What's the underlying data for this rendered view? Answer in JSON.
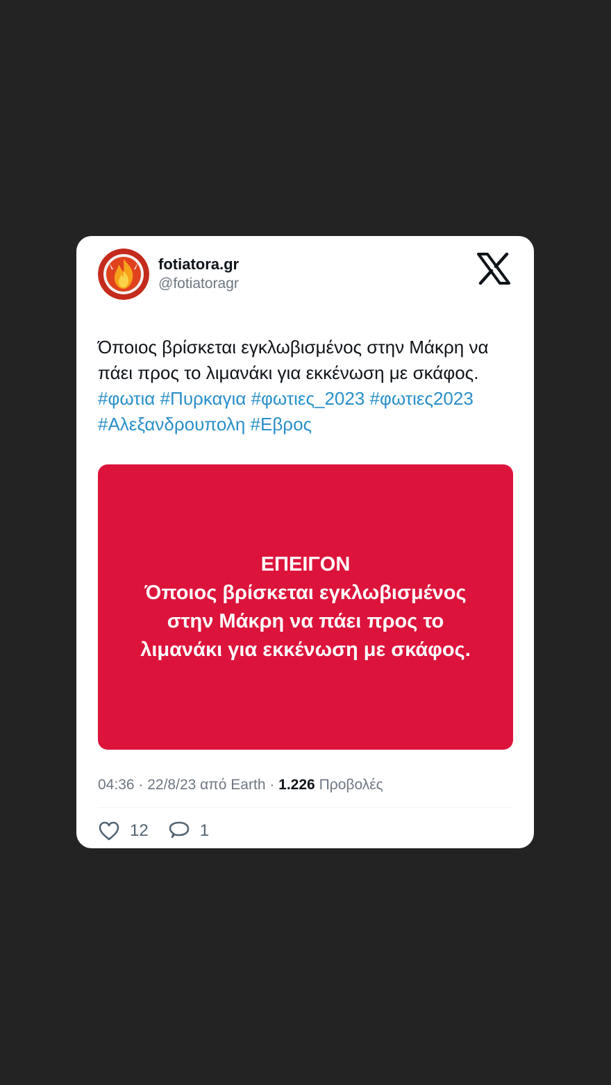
{
  "tweet": {
    "display_name": "fotiatora.gr",
    "handle": "@fotiatoragr",
    "text_plain": "Όποιος βρίσκεται εγκλωβισμένος στην Μάκρη να πάει προς το λιμανάκι για εκκένωση με σκάφος.",
    "hashtags": [
      "#φωτια",
      "#Πυρκαγια",
      "#φωτιες_2023",
      "#φωτιες2023",
      "#Αλεξανδρουπολη",
      "#Εβρος"
    ],
    "media": {
      "line1": "ΕΠΕΙΓΟΝ",
      "line2": "Όποιος βρίσκεται εγκλωβισμένος",
      "line3": "στην Μάκρη να πάει προς το",
      "line4": "λιμανάκι για εκκένωση με σκάφος.",
      "background_color": "#dc143c"
    },
    "meta": {
      "time": "04:36",
      "date": "22/8/23",
      "source": "από Earth",
      "views_count": "1.226",
      "views_label": "Προβολές"
    },
    "actions": {
      "likes": "12",
      "replies": "1"
    }
  },
  "icons": [
    "fire-logo-icon",
    "x-logo-icon",
    "heart-icon",
    "reply-bubble-icon"
  ],
  "colors": {
    "background": "#232323",
    "card": "#ffffff",
    "hashtag": "#2a8fc8",
    "avatar_ring": "#c42b1c"
  }
}
